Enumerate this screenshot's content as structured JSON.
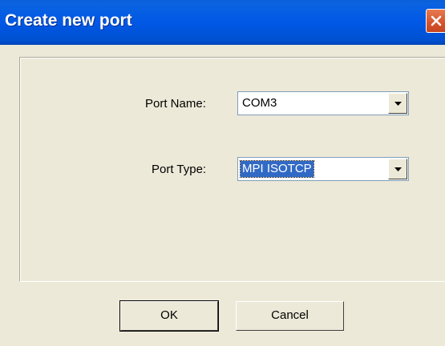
{
  "dialog": {
    "title": "Create new port"
  },
  "form": {
    "port_name_label": "Port Name:",
    "port_name_value": "COM3",
    "port_type_label": "Port Type:",
    "port_type_value": "MPI ISOTCP"
  },
  "buttons": {
    "ok_label": "OK",
    "cancel_label": "Cancel"
  },
  "icons": {
    "close": "close-icon",
    "dropdown": "chevron-down-icon"
  },
  "colors": {
    "titlebar": "#0058e6",
    "dialog_bg": "#ece9d8",
    "selection": "#316ac5",
    "close_button": "#d5532c"
  }
}
